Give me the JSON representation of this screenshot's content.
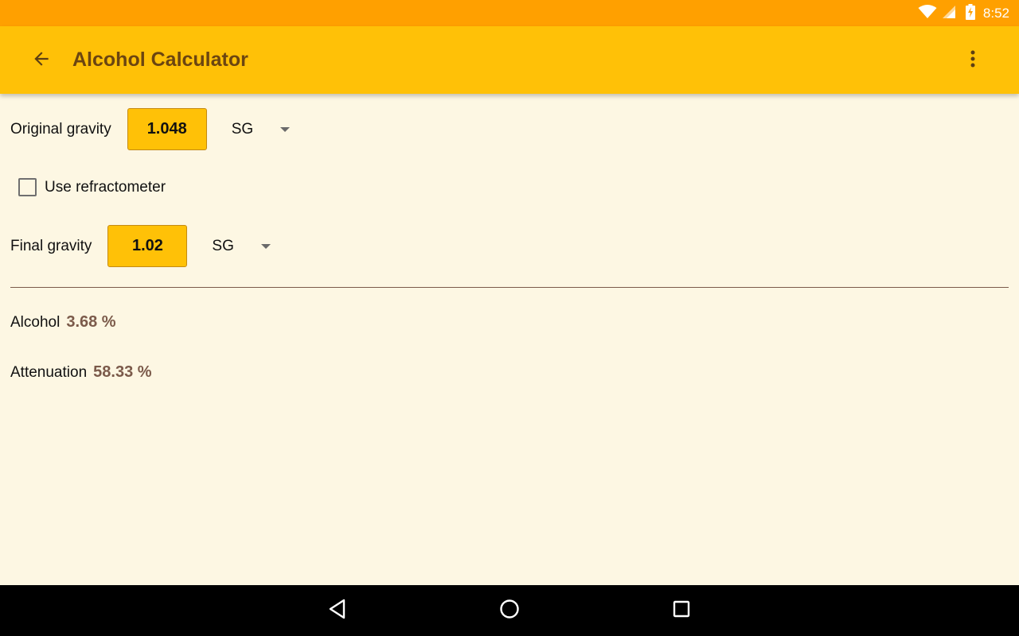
{
  "status_bar": {
    "time": "8:52",
    "icons": [
      "wifi-icon",
      "cellular-signal-icon",
      "battery-charging-icon"
    ]
  },
  "app_bar": {
    "title": "Alcohol Calculator",
    "back_icon": "arrow-back-icon",
    "overflow_icon": "more-vert-icon"
  },
  "form": {
    "original_gravity": {
      "label": "Original gravity",
      "value": "1.048",
      "unit": "SG"
    },
    "refractometer": {
      "label": "Use refractometer",
      "checked": false
    },
    "final_gravity": {
      "label": "Final gravity",
      "value": "1.02",
      "unit": "SG"
    }
  },
  "results": {
    "alcohol": {
      "label": "Alcohol",
      "value": "3.68 %"
    },
    "attenuation": {
      "label": "Attenuation",
      "value": "58.33 %"
    }
  },
  "nav_bar": {
    "buttons": [
      "back-triangle-icon",
      "home-circle-icon",
      "recents-square-icon"
    ]
  },
  "colors": {
    "status_bar": "#ffa000",
    "app_bar": "#ffc107",
    "title_text": "#6b4511",
    "background": "#fdf7e3",
    "result_value": "#7b5a4a",
    "nav_bar": "#000000"
  }
}
